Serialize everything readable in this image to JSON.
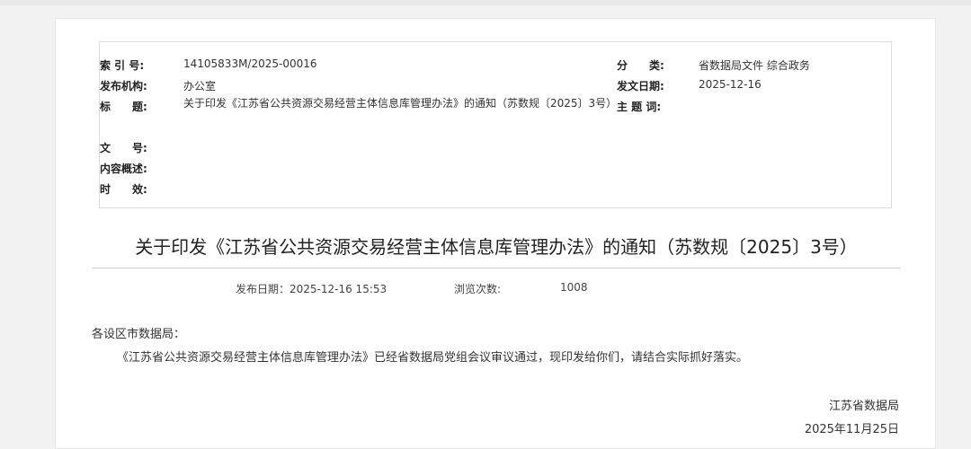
{
  "meta": {
    "index_label": "索 引 号:",
    "index_value": "14105833M/2025-00016",
    "category_label": "分　　类:",
    "category_value": "省数据局文件 综合政务",
    "publisher_label": "发布机构:",
    "publisher_value": "办公室",
    "issue_date_label": "发文日期:",
    "issue_date_value": "2025-12-16",
    "title_label": "标　　题:",
    "title_value": "关于印发《江苏省公共资源交易经营主体信息库管理办法》的通知（苏数规〔2025〕3号）",
    "subject_label": "主 题 词:",
    "subject_value": "",
    "docno_label": "文　　号:",
    "docno_value": "",
    "summary_label": "内容概述:",
    "summary_value": "",
    "validity_label": "时　　效:",
    "validity_value": ""
  },
  "article": {
    "title": "关于印发《江苏省公共资源交易经营主体信息库管理办法》的通知（苏数规〔2025〕3号）",
    "publish_date": "发布日期：2025-12-16 15:53",
    "views_label": "浏览次数:",
    "views_value": "1008",
    "salutation": "各设区市数据局：",
    "body": "《江苏省公共资源交易经营主体信息库管理办法》已经省数据局党组会议审议通过，现印发给你们，请结合实际抓好落实。",
    "signature": "江苏省数据局",
    "sign_date": "2025年11月25日"
  }
}
